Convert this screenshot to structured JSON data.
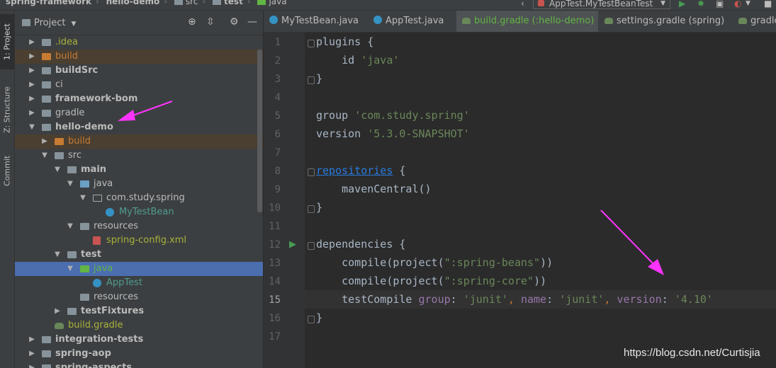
{
  "breadcrumb": {
    "project": "spring-framework",
    "module": "hello-demo",
    "src": "src",
    "test": "test",
    "java": "java"
  },
  "run_config": {
    "label": "AppTest.MyTestBeanTest"
  },
  "tool_stripe": {
    "project": "1: Project",
    "structure": "Z: Structure",
    "commit": "Commit"
  },
  "project_panel": {
    "title": "Project",
    "tree": [
      {
        "label": "idea",
        "prefix": ".",
        "level": 1,
        "arrow": "right",
        "icon": "folder",
        "style": "yellow"
      },
      {
        "label": "build",
        "level": 1,
        "arrow": "right",
        "icon": "folder-orange",
        "style": "orangeTxt",
        "excluded": true
      },
      {
        "label": "buildSrc",
        "level": 1,
        "arrow": "right",
        "icon": "folder",
        "style": "bold"
      },
      {
        "label": "ci",
        "level": 1,
        "arrow": "right",
        "icon": "folder",
        "style": ""
      },
      {
        "label": "framework-bom",
        "level": 1,
        "arrow": "right",
        "icon": "folder",
        "style": "bold"
      },
      {
        "label": "gradle",
        "level": 1,
        "arrow": "right",
        "icon": "folder",
        "style": ""
      },
      {
        "label": "hello-demo",
        "level": 1,
        "arrow": "down",
        "icon": "folder",
        "style": "bold"
      },
      {
        "label": "build",
        "level": 2,
        "arrow": "right",
        "icon": "folder-orange",
        "style": "orangeTxt",
        "excluded": true
      },
      {
        "label": "src",
        "level": 2,
        "arrow": "down",
        "icon": "folder",
        "style": ""
      },
      {
        "label": "main",
        "level": 3,
        "arrow": "down",
        "icon": "folder",
        "style": "bold"
      },
      {
        "label": "java",
        "level": 4,
        "arrow": "down",
        "icon": "folder-blue",
        "style": ""
      },
      {
        "label": "com.study.spring",
        "level": 5,
        "arrow": "down",
        "icon": "package",
        "style": ""
      },
      {
        "label": "MyTestBean",
        "level": 6,
        "arrow": "",
        "icon": "class",
        "style": "teal"
      },
      {
        "label": "resources",
        "level": 4,
        "arrow": "down",
        "icon": "folder",
        "style": ""
      },
      {
        "label": "spring-config.xml",
        "level": 5,
        "arrow": "",
        "icon": "xml",
        "style": "olive"
      },
      {
        "label": "test",
        "level": 3,
        "arrow": "down",
        "icon": "folder",
        "style": "bold"
      },
      {
        "label": "java",
        "level": 4,
        "arrow": "down",
        "icon": "folder-green",
        "style": "green",
        "selected": true
      },
      {
        "label": "AppTest",
        "level": 5,
        "arrow": "",
        "icon": "class",
        "style": "teal"
      },
      {
        "label": "resources",
        "level": 4,
        "arrow": "",
        "icon": "folder",
        "style": ""
      },
      {
        "label": "testFixtures",
        "level": 3,
        "arrow": "right",
        "icon": "folder",
        "style": "bold"
      },
      {
        "label": "build.gradle",
        "level": 2,
        "arrow": "",
        "icon": "gradle",
        "style": "olive"
      },
      {
        "label": "integration-tests",
        "level": 1,
        "arrow": "right",
        "icon": "folder",
        "style": "bold"
      },
      {
        "label": "spring-aop",
        "level": 1,
        "arrow": "right",
        "icon": "folder",
        "style": "bold"
      },
      {
        "label": "spring-aspects",
        "level": 1,
        "arrow": "right",
        "icon": "folder",
        "style": "bold"
      }
    ]
  },
  "tabs": [
    {
      "label": "MyTestBean.java",
      "icon": "class",
      "active": false
    },
    {
      "label": "AppTest.java",
      "icon": "class",
      "active": false
    },
    {
      "label": "build.gradle (:hello-demo)",
      "icon": "gradle",
      "active": true
    },
    {
      "label": "settings.gradle (spring)",
      "icon": "gradle",
      "active": false
    },
    {
      "label": "gradle",
      "icon": "gradle",
      "active": false
    }
  ],
  "editor": {
    "current_line": 15,
    "lines": [
      [
        [
          "plain",
          "plugins {"
        ]
      ],
      [
        [
          "plain",
          "    id "
        ],
        [
          "str",
          "'java'"
        ]
      ],
      [
        [
          "plain",
          "}"
        ]
      ],
      [
        [
          "plain",
          ""
        ]
      ],
      [
        [
          "plain",
          "group "
        ],
        [
          "str",
          "'com.study.spring'"
        ]
      ],
      [
        [
          "plain",
          "version "
        ],
        [
          "str",
          "'5.3.0-SNAPSHOT'"
        ]
      ],
      [
        [
          "plain",
          ""
        ]
      ],
      [
        [
          "link",
          "repositories"
        ],
        [
          "plain",
          " {"
        ]
      ],
      [
        [
          "plain",
          "    mavenCentral()"
        ]
      ],
      [
        [
          "plain",
          "}"
        ]
      ],
      [
        [
          "plain",
          ""
        ]
      ],
      [
        [
          "plain",
          "dependencies {"
        ]
      ],
      [
        [
          "plain",
          "    compile(project("
        ],
        [
          "str",
          "\":spring-beans\""
        ],
        [
          "plain",
          "))"
        ]
      ],
      [
        [
          "plain",
          "    compile(project("
        ],
        [
          "str",
          "\":spring-core\""
        ],
        [
          "plain",
          "))"
        ]
      ],
      [
        [
          "plain",
          "    testCompile "
        ],
        [
          "named",
          "group"
        ],
        [
          "plain",
          ": "
        ],
        [
          "str",
          "'junit'"
        ],
        [
          "op",
          ", "
        ],
        [
          "named",
          "name"
        ],
        [
          "plain",
          ": "
        ],
        [
          "str",
          "'junit'"
        ],
        [
          "op",
          ", "
        ],
        [
          "named",
          "version"
        ],
        [
          "plain",
          ": "
        ],
        [
          "str",
          "'4.10'"
        ]
      ],
      [
        [
          "plain",
          "}"
        ]
      ],
      [
        [
          "plain",
          ""
        ]
      ]
    ]
  },
  "watermark": "https://blog.csdn.net/Curtisjia",
  "colors": {
    "annotation_arrow": "#ff33ff",
    "selection": "#4b6eaf"
  }
}
